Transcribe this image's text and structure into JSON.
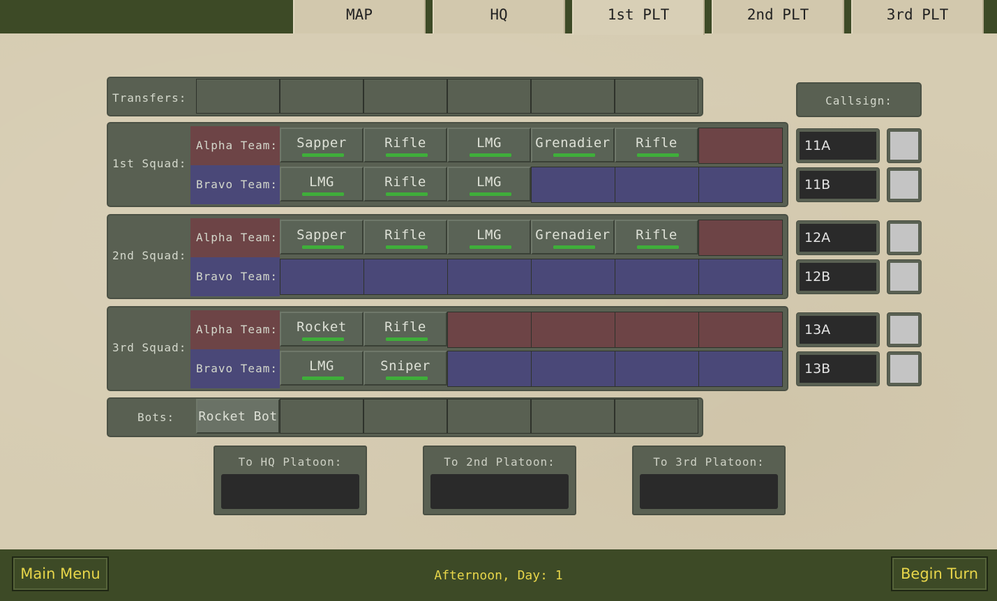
{
  "tabs": [
    "MAP",
    "HQ",
    "1st PLT",
    "2nd PLT",
    "3rd PLT"
  ],
  "active_tab": "1st PLT",
  "transfers_label": "Transfers:",
  "callsign_label": "Callsign:",
  "squads": [
    {
      "label": "1st Squad:",
      "alpha": {
        "label": "Alpha Team:",
        "units": [
          "Sapper",
          "Rifle",
          "LMG",
          "Grenadier",
          "Rifle"
        ],
        "callsign": "11A"
      },
      "bravo": {
        "label": "Bravo Team:",
        "units": [
          "LMG",
          "Rifle",
          "LMG"
        ],
        "callsign": "11B"
      }
    },
    {
      "label": "2nd Squad:",
      "alpha": {
        "label": "Alpha Team:",
        "units": [
          "Sapper",
          "Rifle",
          "LMG",
          "Grenadier",
          "Rifle"
        ],
        "callsign": "12A"
      },
      "bravo": {
        "label": "Bravo Team:",
        "units": [],
        "callsign": "12B"
      }
    },
    {
      "label": "3rd Squad:",
      "alpha": {
        "label": "Alpha Team:",
        "units": [
          "Rocket",
          "Rifle"
        ],
        "callsign": "13A"
      },
      "bravo": {
        "label": "Bravo Team:",
        "units": [
          "LMG",
          "Sniper"
        ],
        "callsign": "13B"
      }
    }
  ],
  "bots": {
    "label": "Bots:",
    "units": [
      "Rocket Bot"
    ]
  },
  "transfer_targets": [
    "To HQ Platoon:",
    "To 2nd Platoon:",
    "To 3rd Platoon:"
  ],
  "footer": {
    "main_menu": "Main Menu",
    "time": "Afternoon, Day: 1",
    "begin_turn": "Begin Turn"
  },
  "colors": {
    "alpha": "#6d4446",
    "bravo": "#4a4878",
    "health": "#3fae3a",
    "accent_text": "#e8d64a",
    "bar_bg": "#3d4a26"
  }
}
